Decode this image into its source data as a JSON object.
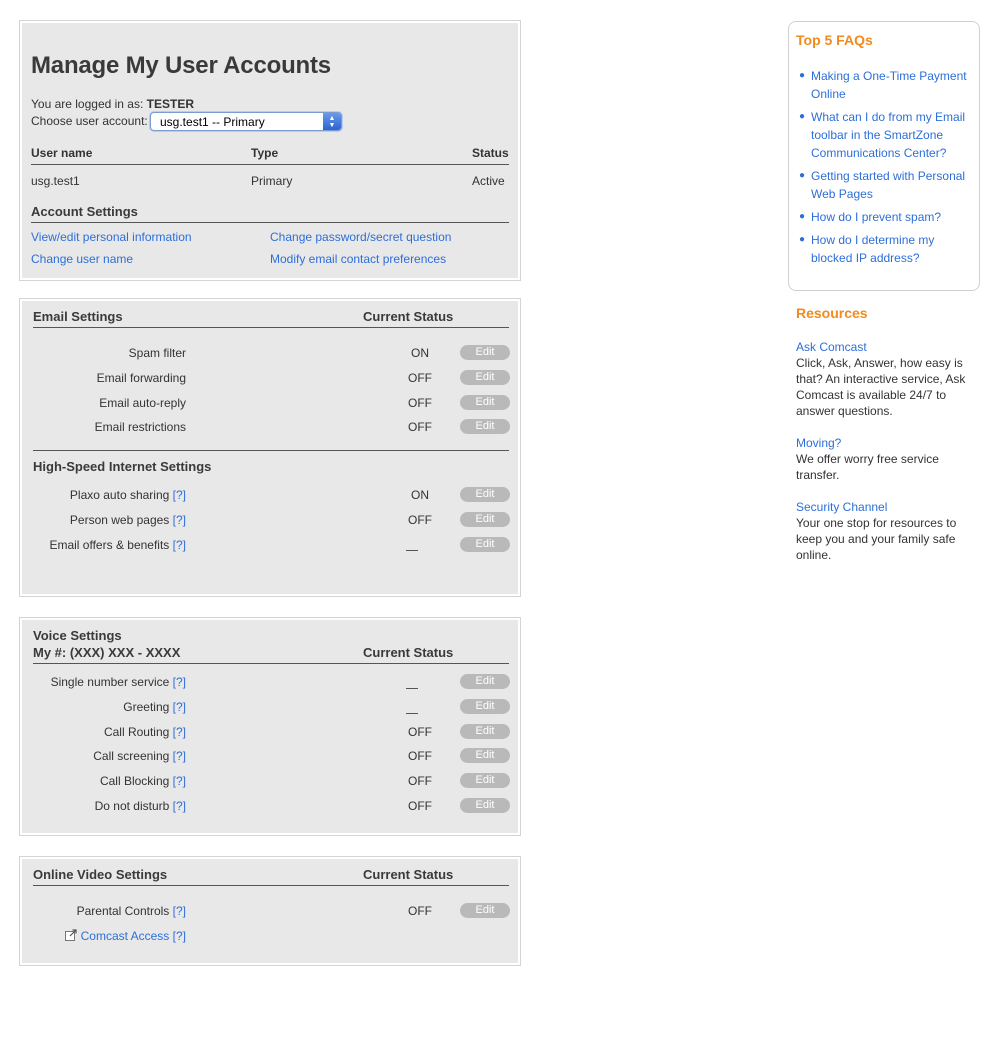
{
  "account": {
    "title": "Manage My User Accounts",
    "logged_in_label": "You are logged in as:",
    "logged_in_user": "TESTER",
    "choose_label": "Choose user account:",
    "selected_account": "usg.test1 -- Primary",
    "columns": [
      "User name",
      "Type",
      "Status"
    ],
    "row": {
      "username": "usg.test1",
      "type": "Primary",
      "status": "Active"
    },
    "settings_title": "Account Settings",
    "links": [
      "View/edit personal information",
      "Change password/secret question",
      "Change user name",
      "Modify email contact preferences"
    ]
  },
  "email": {
    "title": "Email Settings",
    "status_header": "Current Status",
    "edit_label": "Edit",
    "rows": [
      {
        "label": "Spam filter",
        "status": "ON"
      },
      {
        "label": "Email forwarding",
        "status": "OFF"
      },
      {
        "label": "Email auto-reply",
        "status": "OFF"
      },
      {
        "label": "Email restrictions",
        "status": "OFF"
      }
    ]
  },
  "hsi": {
    "title": "High-Speed Internet Settings",
    "help": "[?]",
    "rows": [
      {
        "label": "Plaxo auto sharing",
        "status": "ON"
      },
      {
        "label": "Person web pages",
        "status": "OFF"
      },
      {
        "label": "Email offers & benefits",
        "status": ""
      }
    ]
  },
  "voice": {
    "title": "Voice Settings",
    "number": "My #: (XXX) XXX - XXXX",
    "status_header": "Current Status",
    "help": "[?]",
    "rows": [
      {
        "label": "Single number service",
        "status": ""
      },
      {
        "label": "Greeting",
        "status": ""
      },
      {
        "label": "Call Routing",
        "status": "OFF"
      },
      {
        "label": "Call screening",
        "status": "OFF"
      },
      {
        "label": "Call Blocking",
        "status": "OFF"
      },
      {
        "label": "Do not disturb",
        "status": "OFF"
      }
    ]
  },
  "video": {
    "title": "Online Video Settings",
    "status_header": "Current Status",
    "help": "[?]",
    "rows": [
      {
        "label": "Parental Controls",
        "status": "OFF"
      },
      {
        "label": "Comcast Access",
        "status": ""
      }
    ]
  },
  "faq": {
    "title": "Top 5 FAQs",
    "items": [
      "Making a One-Time Payment Online",
      "What can I do from my Email toolbar in the SmartZone Communications Center?",
      "Getting started with Personal Web Pages",
      "How do I prevent spam?",
      "How do I determine my blocked IP address?"
    ]
  },
  "resources": {
    "title": "Resources",
    "items": [
      {
        "link": "Ask Comcast",
        "text": "Click, Ask, Answer, how easy is that? An interactive service, Ask Comcast is available 24/7 to answer questions."
      },
      {
        "link": "Moving?",
        "text": "We offer worry free service transfer."
      },
      {
        "link": "Security Channel",
        "text": "Your one stop for resources to keep you and your family safe online."
      }
    ]
  },
  "colors": {
    "accent": "#f28a1c",
    "link": "#2d6fd8",
    "panel": "#e8e8e8",
    "edit_button": "#b9b9b9"
  }
}
